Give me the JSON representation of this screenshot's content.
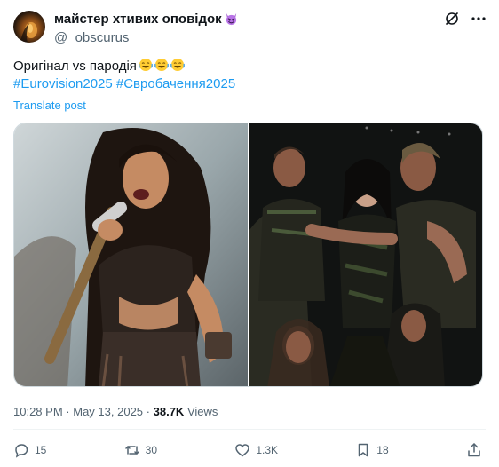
{
  "author": {
    "display_name": "майстер хтивих оповідок",
    "handle": "@_obscurus__"
  },
  "post": {
    "text_main": "Оригінал vs пародія",
    "hashtag_1": "#Eurovision2025",
    "hashtag_2": "#Євробачення2025",
    "translate": "Translate post"
  },
  "meta": {
    "time": "10:28 PM",
    "separator_1": "·",
    "date": "May 13, 2025",
    "separator_2": "·",
    "views_count": "38.7K",
    "views_label": "Views"
  },
  "stats": {
    "replies": "15",
    "reposts": "30",
    "likes": "1.3K",
    "bookmarks": "18"
  },
  "icons": {
    "verified_emoji": "smiling-face-with-horns-icon",
    "reaction_emoji": "face-with-tears-of-joy-icon"
  },
  "colors": {
    "link": "#1d9bf0",
    "text": "#0f1419",
    "muted": "#536471"
  }
}
